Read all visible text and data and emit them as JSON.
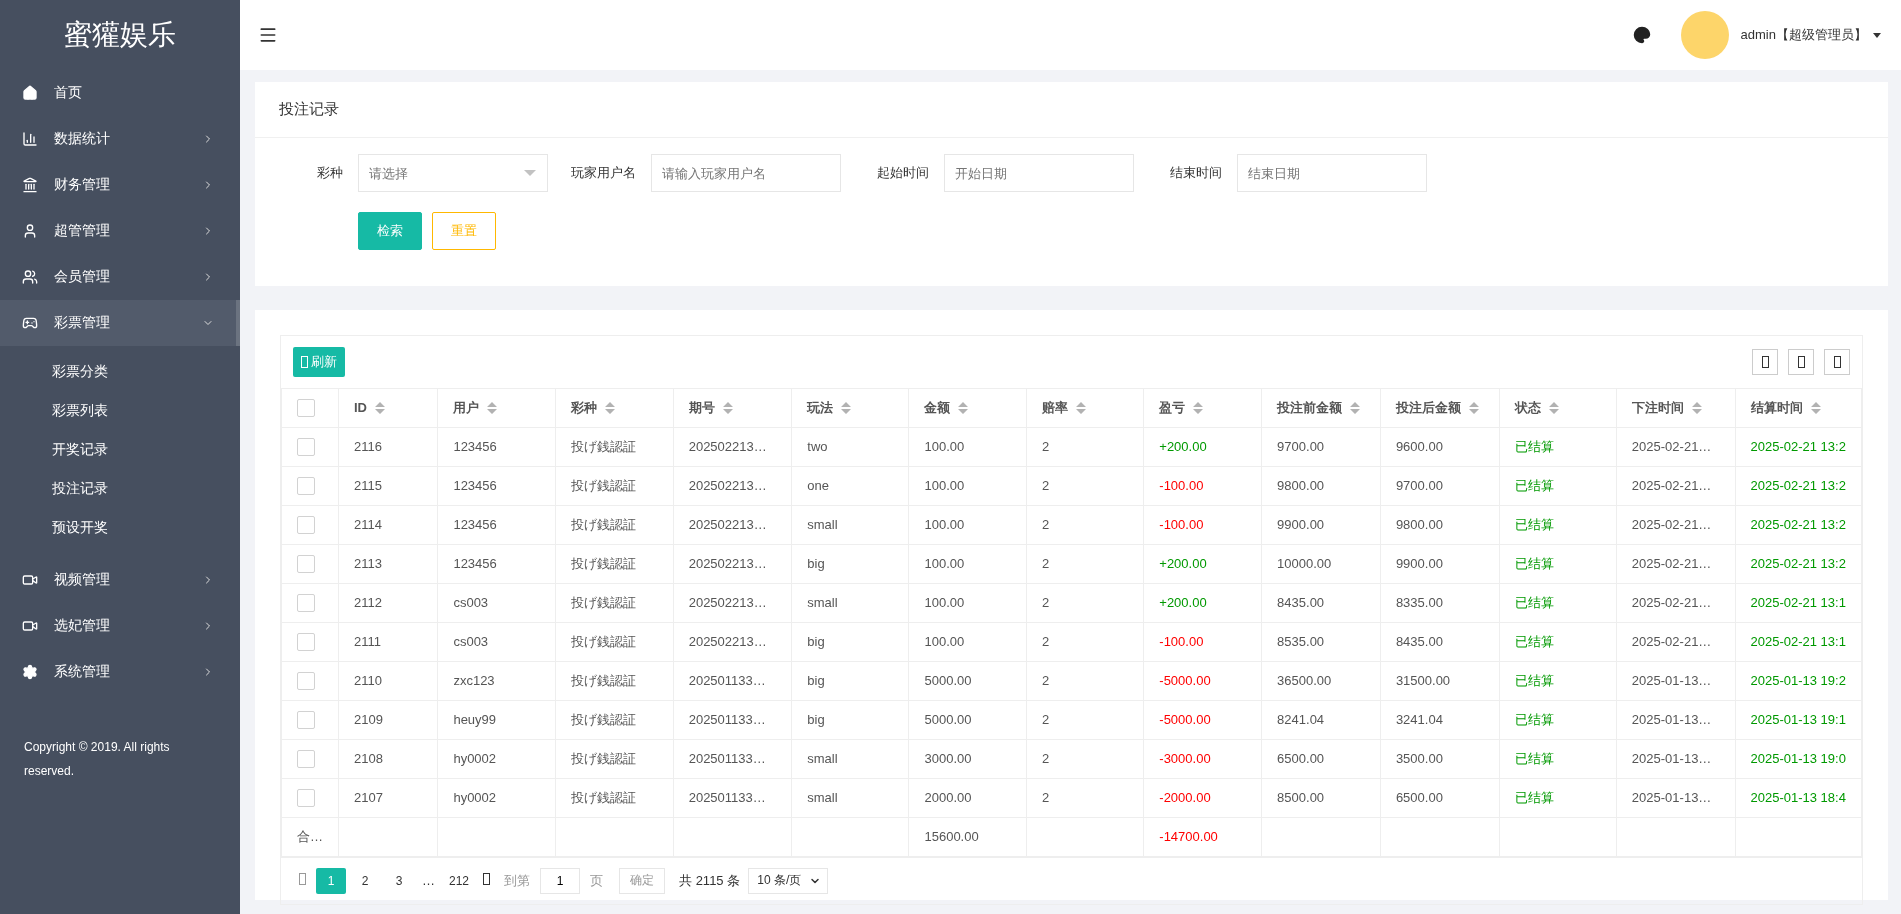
{
  "sidebar": {
    "logo": "蜜獾娱乐",
    "items": [
      {
        "label": "首页",
        "expandable": false,
        "expanded": false,
        "selected": false
      },
      {
        "label": "数据统计",
        "expandable": true,
        "expanded": false,
        "selected": false
      },
      {
        "label": "财务管理",
        "expandable": true,
        "expanded": false,
        "selected": false
      },
      {
        "label": "超管管理",
        "expandable": true,
        "expanded": false,
        "selected": false
      },
      {
        "label": "会员管理",
        "expandable": true,
        "expanded": false,
        "selected": false
      },
      {
        "label": "彩票管理",
        "expandable": true,
        "expanded": true,
        "selected": true,
        "children": [
          {
            "label": "彩票分类"
          },
          {
            "label": "彩票列表"
          },
          {
            "label": "开奖记录"
          },
          {
            "label": "投注记录"
          },
          {
            "label": "预设开奖"
          }
        ]
      },
      {
        "label": "视频管理",
        "expandable": true,
        "expanded": false,
        "selected": false
      },
      {
        "label": "选妃管理",
        "expandable": true,
        "expanded": false,
        "selected": false
      },
      {
        "label": "系统管理",
        "expandable": true,
        "expanded": false,
        "selected": false
      }
    ],
    "copyright": "Copyright © 2019. All rights reserved."
  },
  "header": {
    "user": "admin【超级管理员】"
  },
  "filter": {
    "title": "投注记录",
    "fields": [
      {
        "kind": "select",
        "label": "彩种",
        "placeholder": "请选择"
      },
      {
        "kind": "text",
        "label": "玩家用户名",
        "placeholder": "请输入玩家用户名"
      },
      {
        "kind": "text",
        "label": "起始时间",
        "placeholder": "开始日期"
      },
      {
        "kind": "text",
        "label": "结束时间",
        "placeholder": "结束日期"
      }
    ],
    "search_button": "检索",
    "reset_button": "重置"
  },
  "table": {
    "refresh_button": "刷新",
    "all_checked": false,
    "columns": [
      "ID",
      "用户",
      "彩种",
      "期号",
      "玩法",
      "金额",
      "赔率",
      "盈亏",
      "投注前金额",
      "投注后金额",
      "状态",
      "下注时间",
      "结算时间"
    ],
    "rows": [
      {
        "checked": false,
        "id": "2116",
        "user": "123456",
        "lottery": "投げ銭認証",
        "issue": "202502213…",
        "play": "two",
        "amount": "100.00",
        "odds": "2",
        "profit": {
          "text": "+200.00",
          "color": "#009900"
        },
        "before": "9700.00",
        "after": "9600.00",
        "status": "已结算",
        "bet_time": "2025-02-21…",
        "settle_time": "2025-02-21 13:2"
      },
      {
        "checked": false,
        "id": "2115",
        "user": "123456",
        "lottery": "投げ銭認証",
        "issue": "202502213…",
        "play": "one",
        "amount": "100.00",
        "odds": "2",
        "profit": {
          "text": "-100.00",
          "color": "#ff0000"
        },
        "before": "9800.00",
        "after": "9700.00",
        "status": "已结算",
        "bet_time": "2025-02-21…",
        "settle_time": "2025-02-21 13:2"
      },
      {
        "checked": false,
        "id": "2114",
        "user": "123456",
        "lottery": "投げ銭認証",
        "issue": "202502213…",
        "play": "small",
        "amount": "100.00",
        "odds": "2",
        "profit": {
          "text": "-100.00",
          "color": "#ff0000"
        },
        "before": "9900.00",
        "after": "9800.00",
        "status": "已结算",
        "bet_time": "2025-02-21…",
        "settle_time": "2025-02-21 13:2"
      },
      {
        "checked": false,
        "id": "2113",
        "user": "123456",
        "lottery": "投げ銭認証",
        "issue": "202502213…",
        "play": "big",
        "amount": "100.00",
        "odds": "2",
        "profit": {
          "text": "+200.00",
          "color": "#009900"
        },
        "before": "10000.00",
        "after": "9900.00",
        "status": "已结算",
        "bet_time": "2025-02-21…",
        "settle_time": "2025-02-21 13:2"
      },
      {
        "checked": false,
        "id": "2112",
        "user": "cs003",
        "lottery": "投げ銭認証",
        "issue": "202502213…",
        "play": "small",
        "amount": "100.00",
        "odds": "2",
        "profit": {
          "text": "+200.00",
          "color": "#009900"
        },
        "before": "8435.00",
        "after": "8335.00",
        "status": "已结算",
        "bet_time": "2025-02-21…",
        "settle_time": "2025-02-21 13:1"
      },
      {
        "checked": false,
        "id": "2111",
        "user": "cs003",
        "lottery": "投げ銭認証",
        "issue": "202502213…",
        "play": "big",
        "amount": "100.00",
        "odds": "2",
        "profit": {
          "text": "-100.00",
          "color": "#ff0000"
        },
        "before": "8535.00",
        "after": "8435.00",
        "status": "已结算",
        "bet_time": "2025-02-21…",
        "settle_time": "2025-02-21 13:1"
      },
      {
        "checked": false,
        "id": "2110",
        "user": "zxc123",
        "lottery": "投げ銭認証",
        "issue": "202501133…",
        "play": "big",
        "amount": "5000.00",
        "odds": "2",
        "profit": {
          "text": "-5000.00",
          "color": "#ff0000"
        },
        "before": "36500.00",
        "after": "31500.00",
        "status": "已结算",
        "bet_time": "2025-01-13…",
        "settle_time": "2025-01-13 19:2"
      },
      {
        "checked": false,
        "id": "2109",
        "user": "heuy99",
        "lottery": "投げ銭認証",
        "issue": "202501133…",
        "play": "big",
        "amount": "5000.00",
        "odds": "2",
        "profit": {
          "text": "-5000.00",
          "color": "#ff0000"
        },
        "before": "8241.04",
        "after": "3241.04",
        "status": "已结算",
        "bet_time": "2025-01-13…",
        "settle_time": "2025-01-13 19:1"
      },
      {
        "checked": false,
        "id": "2108",
        "user": "hy0002",
        "lottery": "投げ銭認証",
        "issue": "202501133…",
        "play": "small",
        "amount": "3000.00",
        "odds": "2",
        "profit": {
          "text": "-3000.00",
          "color": "#ff0000"
        },
        "before": "6500.00",
        "after": "3500.00",
        "status": "已结算",
        "bet_time": "2025-01-13…",
        "settle_time": "2025-01-13 19:0"
      },
      {
        "checked": false,
        "id": "2107",
        "user": "hy0002",
        "lottery": "投げ銭認証",
        "issue": "202501133…",
        "play": "small",
        "amount": "2000.00",
        "odds": "2",
        "profit": {
          "text": "-2000.00",
          "color": "#ff0000"
        },
        "before": "8500.00",
        "after": "6500.00",
        "status": "已结算",
        "bet_time": "2025-01-13…",
        "settle_time": "2025-01-13 18:4"
      }
    ],
    "total": {
      "label": "合…",
      "amount": "15600.00",
      "profit": {
        "text": "-14700.00",
        "color": "#ff0000"
      }
    }
  },
  "pagination": {
    "pages": [
      {
        "label": "1",
        "selected": true
      },
      {
        "label": "2",
        "selected": false
      },
      {
        "label": "3",
        "selected": false
      }
    ],
    "ellipsis": "…",
    "last_page": "212",
    "goto_label": "到第",
    "goto_value": "1",
    "page_unit": "页",
    "confirm": "确定",
    "total": "共 2115 条",
    "page_size": "10 条/页"
  }
}
